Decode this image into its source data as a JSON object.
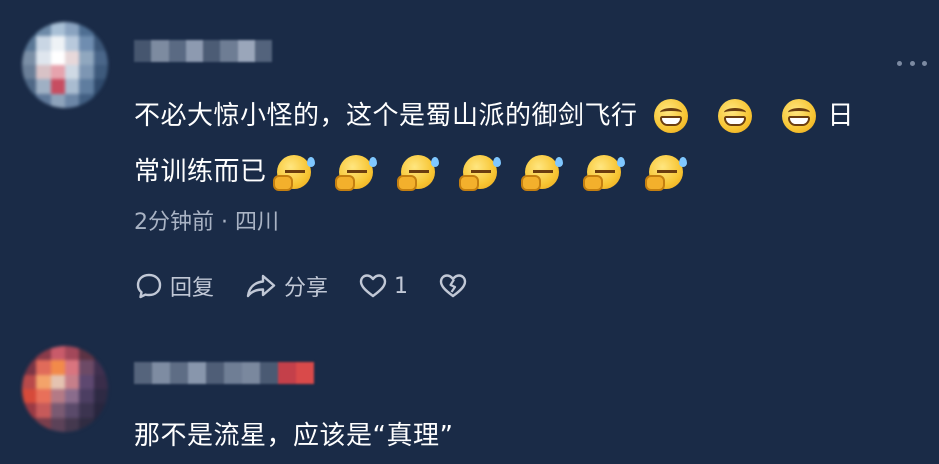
{
  "comments": [
    {
      "text_line1": "不必大惊小怪的，这个是蜀山派的御剑飞行",
      "text_line1_tail": "日",
      "text_line2": "常训练而已",
      "emojis_line1": [
        "grin-emoji",
        "grin-emoji",
        "grin-emoji"
      ],
      "emojis_line2": [
        "thinking-emoji",
        "thinking-emoji",
        "thinking-emoji",
        "thinking-emoji",
        "thinking-emoji",
        "thinking-emoji",
        "thinking-emoji"
      ],
      "meta": "2分钟前 · 四川",
      "actions": {
        "reply_label": "回复",
        "share_label": "分享",
        "like_count": "1"
      }
    },
    {
      "text_line1": "那不是流星，应该是“真理”"
    }
  ],
  "colors": {
    "background": "#1a2b47",
    "text": "#ffffff",
    "meta": "#a9b3c4",
    "icon": "#c1c8d6"
  },
  "icons": [
    "more-icon",
    "reply-icon",
    "share-icon",
    "like-icon",
    "dislike-icon"
  ]
}
